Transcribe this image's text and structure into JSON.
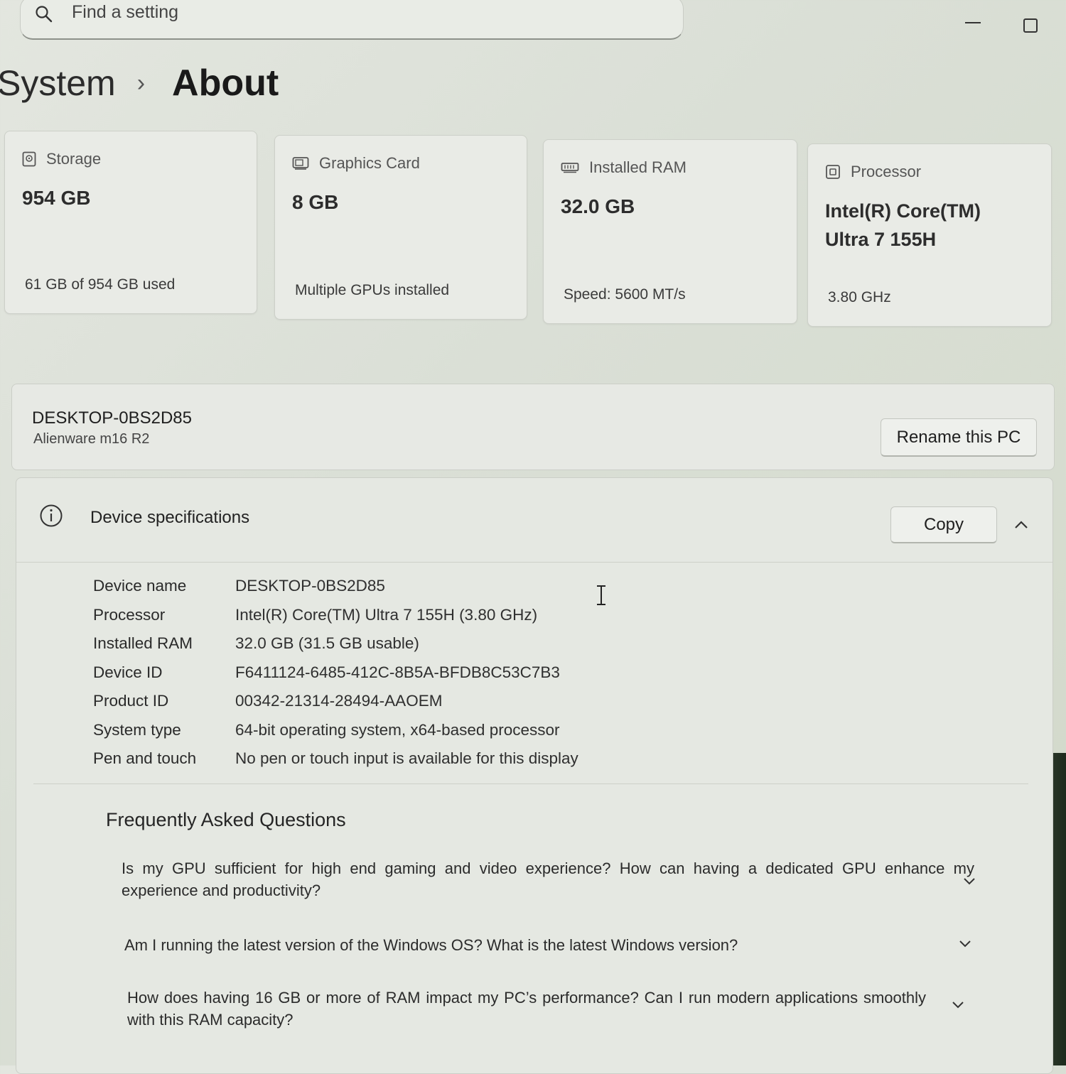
{
  "search": {
    "placeholder": "Find a setting"
  },
  "breadcrumb": {
    "parent": "System",
    "separator": "›",
    "current": "About"
  },
  "cards": [
    {
      "icon": "storage-icon",
      "title": "Storage",
      "value": "954 GB",
      "subtitle": "61 GB of 954 GB used"
    },
    {
      "icon": "graphics-card-icon",
      "title": "Graphics Card",
      "value": "8 GB",
      "subtitle": "Multiple GPUs installed"
    },
    {
      "icon": "ram-icon",
      "title": "Installed RAM",
      "value": "32.0 GB",
      "subtitle": "Speed: 5600 MT/s"
    },
    {
      "icon": "processor-icon",
      "title": "Processor",
      "value_line1": "Intel(R) Core(TM)",
      "value_line2": "Ultra 7 155H",
      "subtitle": "3.80 GHz"
    }
  ],
  "pc": {
    "name": "DESKTOP-0BS2D85",
    "model": "Alienware m16 R2",
    "rename_label": "Rename this PC"
  },
  "specs": {
    "title": "Device specifications",
    "copy_label": "Copy",
    "rows": [
      {
        "label": "Device name",
        "value": "DESKTOP-0BS2D85"
      },
      {
        "label": "Processor",
        "value": "Intel(R) Core(TM) Ultra 7 155H (3.80 GHz)"
      },
      {
        "label": "Installed RAM",
        "value": "32.0 GB (31.5 GB usable)"
      },
      {
        "label": "Device ID",
        "value": "F6411124-6485-412C-8B5A-BFDB8C53C7B3"
      },
      {
        "label": "Product ID",
        "value": "00342-21314-28494-AAOEM"
      },
      {
        "label": "System type",
        "value": "64-bit operating system, x64-based processor"
      },
      {
        "label": "Pen and touch",
        "value": "No pen or touch input is available for this display"
      }
    ]
  },
  "faq": {
    "title": "Frequently Asked Questions",
    "items": [
      "Is my GPU sufficient for high end gaming and video experience? How can having a dedicated GPU enhance my experience and productivity?",
      "Am I running the latest version of the Windows OS? What is the latest Windows version?",
      "How does having 16 GB or more of RAM impact my PC’s performance? Can I run modern applications smoothly with this RAM capacity?"
    ]
  }
}
